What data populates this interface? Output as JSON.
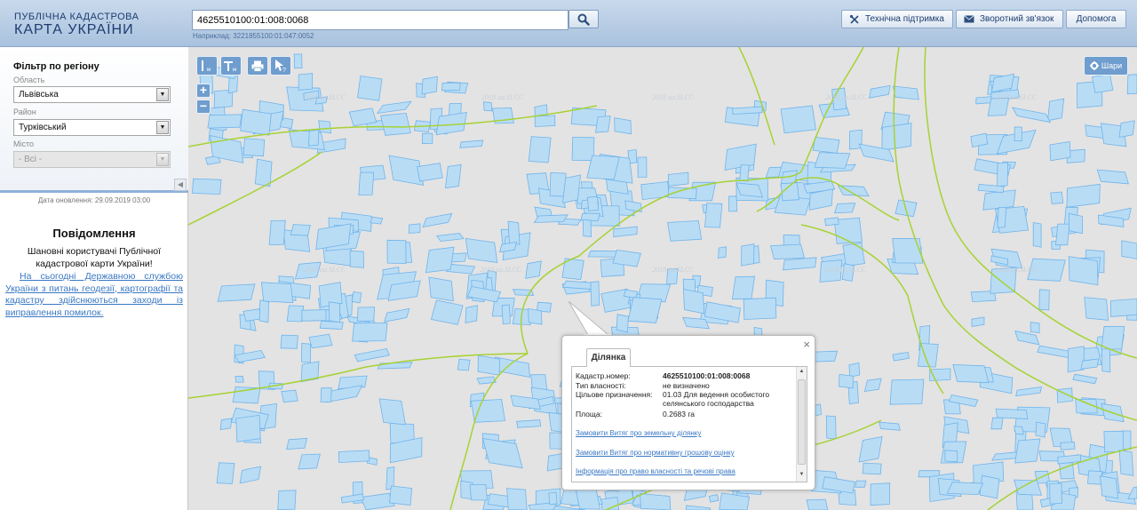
{
  "header": {
    "logo_line1": "ПУБЛІЧНА КАДАСТРОВА",
    "logo_line2": "КАРТА УКРАЇНИ",
    "search_value": "4625510100:01:008:0068",
    "search_hint": "Наприклад: 3221855100:01:047:0052",
    "buttons": {
      "support": "Технічна підтримка",
      "feedback": "Зворотний зв'язок",
      "help": "Допомога"
    }
  },
  "sidebar": {
    "filter_title": "Фільтр по регіону",
    "region_label": "Область",
    "region_value": "Львівська",
    "district_label": "Район",
    "district_value": "Турківський",
    "city_label": "Місто",
    "city_value": "- Всі -",
    "update_date": "Дата оновлення: 29.09.2019 03:00",
    "notice_title": "Повідомлення",
    "notice_greeting": "Шановні користувачі Публічної кадастрової карти України!",
    "notice_link": "На сьогодні Державною службою України з питань геодезії, картографії та кадастру здійснюються заходи із виправлення помилок."
  },
  "map": {
    "watermark": "2018 ua.SLCC",
    "layers_label": "Шари",
    "zoom_in": "+",
    "zoom_out": "−",
    "tools": [
      "ruler-icon",
      "area-measure-icon",
      "print-icon",
      "identify-icon"
    ]
  },
  "popup": {
    "close": "×",
    "tab": "Ділянка",
    "rows": [
      {
        "key": "Кадастр.номер:",
        "value": "4625510100:01:008:0068"
      },
      {
        "key": "Тип власності:",
        "value": "не визначено"
      },
      {
        "key": "Цільове призначення:",
        "value": "01.03 Для ведення особистого селянського господарства"
      },
      {
        "key": "Площа:",
        "value": "0.2683 га"
      }
    ],
    "links": [
      "Замовити Витяг про земельну ділянку",
      "Замовити Витяг про нормативну грошову оцінку",
      "Інформація про право власності та речові права"
    ]
  },
  "colors": {
    "parcel_fill": "#b9dcf5",
    "parcel_stroke": "#6fb4ea",
    "boundary": "#a6d233",
    "toolbar": "#6f9dce",
    "link": "#3a78c3"
  }
}
